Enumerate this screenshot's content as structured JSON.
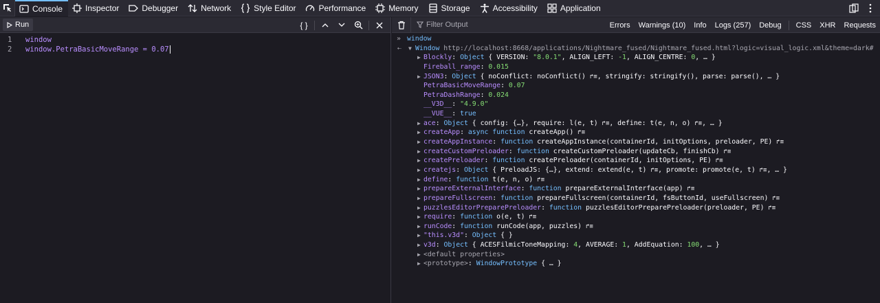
{
  "toolbar": {
    "tabs": [
      {
        "label": "Console",
        "icon": "console-icon",
        "active": true
      },
      {
        "label": "Inspector",
        "icon": "inspector-icon"
      },
      {
        "label": "Debugger",
        "icon": "debugger-icon"
      },
      {
        "label": "Network",
        "icon": "network-icon"
      },
      {
        "label": "Style Editor",
        "icon": "style-editor-icon"
      },
      {
        "label": "Performance",
        "icon": "performance-icon"
      },
      {
        "label": "Memory",
        "icon": "memory-icon"
      },
      {
        "label": "Storage",
        "icon": "storage-icon"
      },
      {
        "label": "Accessibility",
        "icon": "accessibility-icon"
      },
      {
        "label": "Application",
        "icon": "application-icon"
      }
    ]
  },
  "editor": {
    "run_label": "Run",
    "tools_braces": "{ }",
    "lines": [
      {
        "num": "1",
        "text": "window"
      },
      {
        "num": "2",
        "text": "window.PetraBasicMoveRange = 0.07"
      }
    ]
  },
  "output": {
    "filter_placeholder": "Filter Output",
    "levels": [
      "Errors",
      "Warnings (10)",
      "Info",
      "Logs (257)",
      "Debug"
    ],
    "extra": [
      "CSS",
      "XHR",
      "Requests"
    ],
    "input_echo": "window",
    "result_head": {
      "label": "Window",
      "url": "http://localhost:8668/applications/Nightmare_fused/Nightmare_fused.html?logic=visual_logic.xml&theme=dark#"
    },
    "rows": [
      {
        "tw": "▶",
        "key": "Blockly",
        "rest": ": Object { VERSION: \"8.0.1\", ALIGN_LEFT: -1, ALIGN_CENTRE: 0, … }"
      },
      {
        "tw": "",
        "key": "Fireball_range",
        "rest": ": 0.015"
      },
      {
        "tw": "▶",
        "key": "JSON3",
        "rest": ": Object { noConflict: noConflict() ↱≡, stringify: stringify(), parse: parse(), … }"
      },
      {
        "tw": "",
        "key": "PetraBasicMoveRange",
        "rest": ": 0.07"
      },
      {
        "tw": "",
        "key": "PetraDashRange",
        "rest": ": 0.024"
      },
      {
        "tw": "",
        "key": "__V3D__",
        "rest": ": \"4.9.0\""
      },
      {
        "tw": "",
        "key": "__VUE__",
        "rest": ": true"
      },
      {
        "tw": "▶",
        "key": "ace",
        "rest": ": Object { config: {…}, require: l(e, t) ↱≡, define: t(e, n, o) ↱≡, … }"
      },
      {
        "tw": "▶",
        "key": "createApp",
        "rest": ": async function createApp() ↱≡"
      },
      {
        "tw": "▶",
        "key": "createAppInstance",
        "rest": ": function createAppInstance(containerId, initOptions, preloader, PE) ↱≡"
      },
      {
        "tw": "▶",
        "key": "createCustomPreloader",
        "rest": ": function createCustomPreloader(updateCb, finishCb) ↱≡"
      },
      {
        "tw": "▶",
        "key": "createPreloader",
        "rest": ": function createPreloader(containerId, initOptions, PE) ↱≡"
      },
      {
        "tw": "▶",
        "key": "createjs",
        "rest": ": Object { PreloadJS: {…}, extend: extend(e, t) ↱≡, promote: promote(e, t) ↱≡, … }"
      },
      {
        "tw": "▶",
        "key": "define",
        "rest": ": function t(e, n, o) ↱≡"
      },
      {
        "tw": "▶",
        "key": "prepareExternalInterface",
        "rest": ": function prepareExternalInterface(app) ↱≡"
      },
      {
        "tw": "▶",
        "key": "prepareFullscreen",
        "rest": ": function prepareFullscreen(containerId, fsButtonId, useFullscreen) ↱≡"
      },
      {
        "tw": "▶",
        "key": "puzzlesEditorPreparePreloader",
        "rest": ": function puzzlesEditorPreparePreloader(preloader, PE) ↱≡"
      },
      {
        "tw": "▶",
        "key": "require",
        "rest": ": function o(e, t) ↱≡"
      },
      {
        "tw": "▶",
        "key": "runCode",
        "rest": ": function runCode(app, puzzles) ↱≡"
      },
      {
        "tw": "▶",
        "key": "\"this.v3d\"",
        "rest": ": Object {  }"
      },
      {
        "tw": "▶",
        "key": "v3d",
        "rest": ": Object { ACESFilmicToneMapping: 4, AVERAGE: 1, AddEquation: 100, … }"
      },
      {
        "tw": "▶",
        "key": "<default properties>",
        "rest": ""
      },
      {
        "tw": "▶",
        "key": "<prototype>",
        "rest": ": WindowPrototype { … }"
      }
    ]
  },
  "colors": {
    "background": "#1c1b22",
    "toolbar": "#2b2a33",
    "accent": "#75bfff",
    "keyword": "#b98eff",
    "number": "#86de74",
    "param": "#ff7de9"
  }
}
